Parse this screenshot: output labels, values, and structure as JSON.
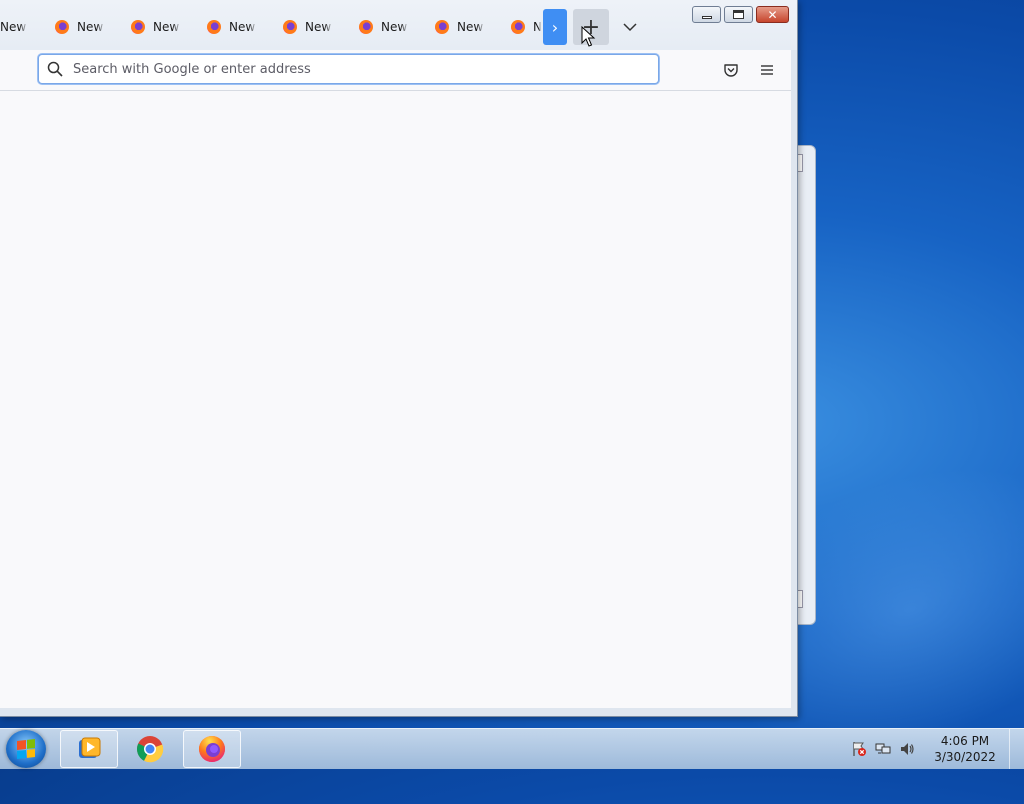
{
  "browser": {
    "tabs": [
      {
        "label": "New Tab"
      },
      {
        "label": "New Tab"
      },
      {
        "label": "New Tab"
      },
      {
        "label": "New Tab"
      },
      {
        "label": "New Tab"
      },
      {
        "label": "New Tab"
      },
      {
        "label": "New Tab"
      },
      {
        "label": "New Tab"
      }
    ],
    "urlbar": {
      "placeholder": "Search with Google or enter address",
      "value": ""
    },
    "toolbar_icons": [
      "pocket-icon",
      "menu-icon"
    ]
  },
  "taskbar": {
    "pinned": [
      "windows-media-player-icon",
      "chrome-icon",
      "firefox-icon"
    ],
    "tray_icons": [
      "action-center-icon",
      "network-icon",
      "volume-icon"
    ],
    "clock": {
      "time": "4:06 PM",
      "date": "3/30/2022"
    }
  },
  "colors": {
    "accent": "#3f8ef3",
    "desktop": "#1763c4",
    "close_button": "#c7452d"
  }
}
